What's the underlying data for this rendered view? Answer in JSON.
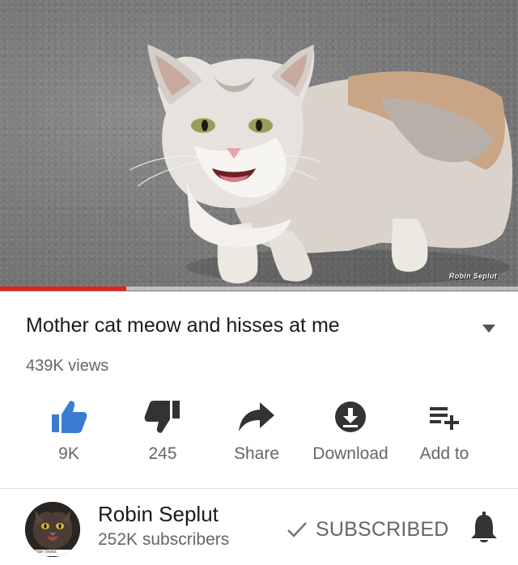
{
  "video": {
    "watermark": "Robin Seplut",
    "progress": 0.243,
    "progress_color": "#e62117"
  },
  "title": "Mother cat meow and hisses at me",
  "views": "439K views",
  "actions": {
    "like": {
      "label": "9K",
      "icon": "thumbs-up-icon",
      "color": "#3a7bd5"
    },
    "dislike": {
      "label": "245",
      "icon": "thumbs-down-icon"
    },
    "share": {
      "label": "Share",
      "icon": "share-arrow-icon"
    },
    "download": {
      "label": "Download",
      "icon": "download-icon"
    },
    "add_to": {
      "label": "Add to",
      "icon": "playlist-add-icon"
    }
  },
  "channel": {
    "name": "Robin Seplut",
    "subscribers": "252K subscribers",
    "avatar_caption": "Robin Seplut",
    "subscribe_label": "SUBSCRIBED"
  }
}
